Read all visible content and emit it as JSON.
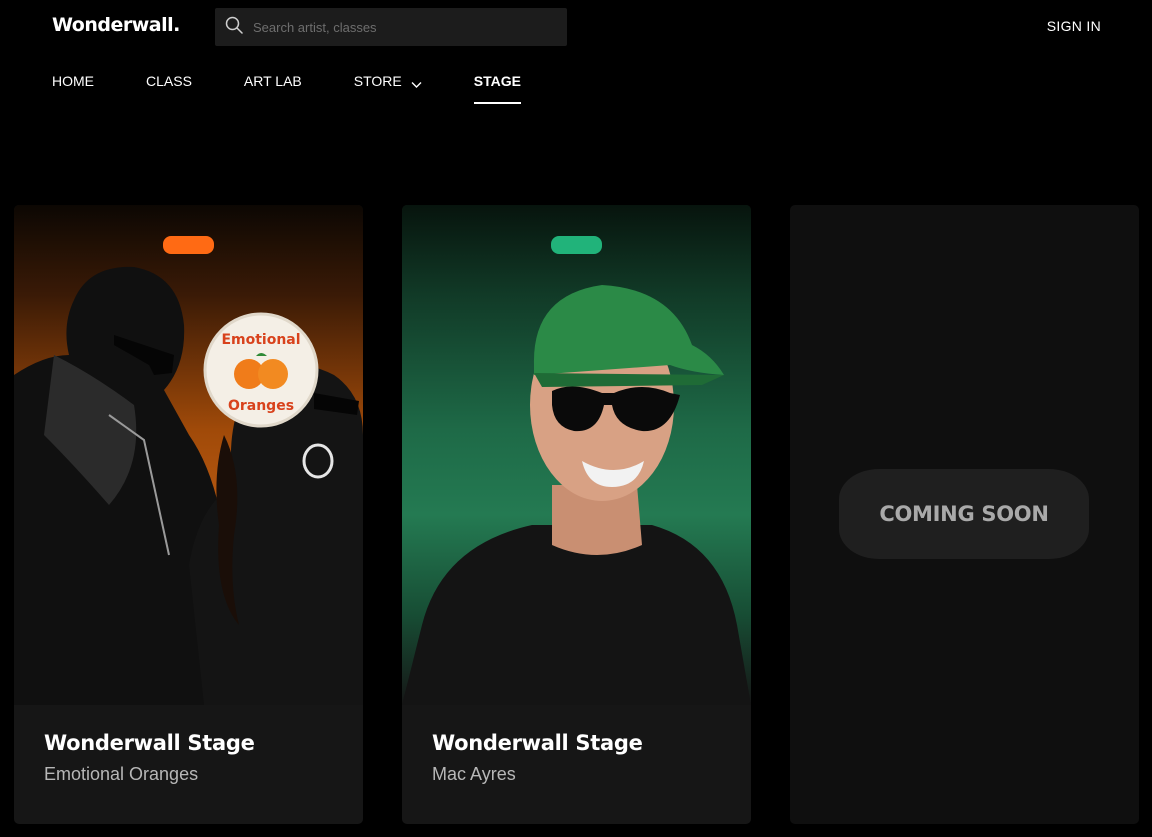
{
  "header": {
    "logo": "Wonderwall.",
    "search_placeholder": "Search artist, classes",
    "sign_in": "SIGN IN"
  },
  "nav": {
    "items": [
      {
        "label": "HOME"
      },
      {
        "label": "CLASS"
      },
      {
        "label": "ART LAB"
      },
      {
        "label": "STORE",
        "has_dropdown": true
      },
      {
        "label": "STAGE",
        "active": true
      }
    ]
  },
  "cards": [
    {
      "title": "Wonderwall Stage",
      "subtitle": "Emotional Oranges",
      "badge_color": "#ff6a14",
      "sticker_line1": "Emotional",
      "sticker_line2": "Oranges"
    },
    {
      "title": "Wonderwall Stage",
      "subtitle": "Mac Ayres",
      "badge_color": "#21b37a"
    },
    {
      "status": "COMING SOON"
    }
  ]
}
